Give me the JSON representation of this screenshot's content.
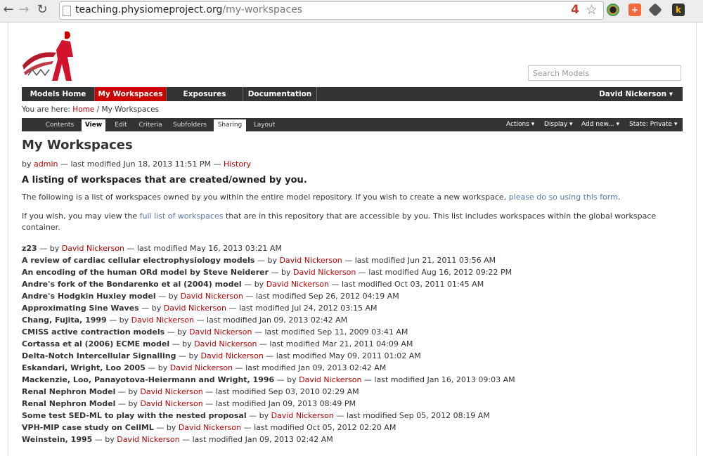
{
  "browser": {
    "url_host": "teaching.physiomeproject.org",
    "url_path": "/my-workspaces",
    "badge_count": "4",
    "back_icon": "back-arrow-icon",
    "forward_icon": "forward-arrow-icon",
    "reload_icon": "reload-icon"
  },
  "search": {
    "placeholder": "Search Models"
  },
  "mainnav": {
    "items": [
      "Models Home",
      "My Workspaces",
      "Exposures",
      "Documentation"
    ],
    "user": "David Nickerson ▾",
    "active_color": "#cc0000"
  },
  "breadcrumb": {
    "prefix": "You are here:",
    "home": "Home",
    "separator": "/",
    "current": "My Workspaces"
  },
  "editbar": {
    "tabs": [
      "Contents",
      "View",
      "Edit",
      "Criteria",
      "Subfolders",
      "Sharing",
      "Layout"
    ],
    "actions": "Actions ▾",
    "display": "Display ▾",
    "add_new": "Add new... ▾",
    "state": "State: Private ▾"
  },
  "page": {
    "title": "My Workspaces",
    "by": "by",
    "author": "admin",
    "modified": "— last modified Jun 18, 2013 11:51 PM —",
    "history": "History",
    "subtitle": "A listing of workspaces that are created/owned by you.",
    "para1_text": "The following is a list of workspaces owned by you within the entire model repository. If you wish to create a new workspace,",
    "para1_link": "please do so using this form",
    "para1_end": ".",
    "para2_text1": "If you wish, you may view the",
    "para2_link": "full list of workspaces",
    "para2_text2": "that are in this repository that are accessible by you. This list includes workspaces within the global workspace container."
  },
  "workspaces": [
    {
      "title": "z23",
      "author": "David Nickerson",
      "modified": "May 16, 2013 03:21 AM"
    },
    {
      "title": "A review of cardiac cellular electrophysiology models",
      "author": "David Nickerson",
      "modified": "Jun 21, 2011 03:56 AM"
    },
    {
      "title": "An encoding of the human ORd model by Steve Neiderer",
      "author": "David Nickerson",
      "modified": "Aug 16, 2012 09:22 PM"
    },
    {
      "title": "Andre's fork of the Bondarenko et al (2004) model",
      "author": "David Nickerson",
      "modified": "Oct 03, 2011 01:45 AM"
    },
    {
      "title": "Andre's Hodgkin Huxley model",
      "author": "David Nickerson",
      "modified": "Sep 26, 2012 04:19 AM"
    },
    {
      "title": "Approximating Sine Waves",
      "author": "David Nickerson",
      "modified": "Jul 24, 2012 03:15 AM"
    },
    {
      "title": "Chang, Fujita, 1999",
      "author": "David Nickerson",
      "modified": "Jan 09, 2013 02:42 AM"
    },
    {
      "title": "CMISS active contraction models",
      "author": "David Nickerson",
      "modified": "Sep 11, 2009 03:41 AM"
    },
    {
      "title": "Cortassa et al (2006) ECME model",
      "author": "David Nickerson",
      "modified": "Mar 21, 2011 04:09 AM"
    },
    {
      "title": "Delta-Notch Intercellular Signalling",
      "author": "David Nickerson",
      "modified": "May 09, 2011 01:02 AM"
    },
    {
      "title": "Eskandari, Wright, Loo 2005",
      "author": "David Nickerson",
      "modified": "Jan 09, 2013 02:42 AM"
    },
    {
      "title": "Mackenzie, Loo, Panayotova-Heiermann and Wright, 1996",
      "author": "David Nickerson",
      "modified": "Jan 16, 2013 09:03 AM"
    },
    {
      "title": "Renal Nephron Model",
      "author": "David Nickerson",
      "modified": "Sep 03, 2010 02:29 AM"
    },
    {
      "title": "Renal Nephron Model",
      "author": "David Nickerson",
      "modified": "Jan 09, 2013 08:49 PM"
    },
    {
      "title": "Some test SED-ML to play with the nested proposal",
      "author": "David Nickerson",
      "modified": "Sep 05, 2012 08:19 AM"
    },
    {
      "title": "VPH-MIP case study on CellML",
      "author": "David Nickerson",
      "modified": "Oct 05, 2012 02:20 AM"
    },
    {
      "title": "Weinstein, 1995",
      "author": "David Nickerson",
      "modified": "Jan 09, 2013 02:42 AM"
    }
  ],
  "list_labels": {
    "sep_by": " — by ",
    "sep_mod": " — last modified "
  }
}
